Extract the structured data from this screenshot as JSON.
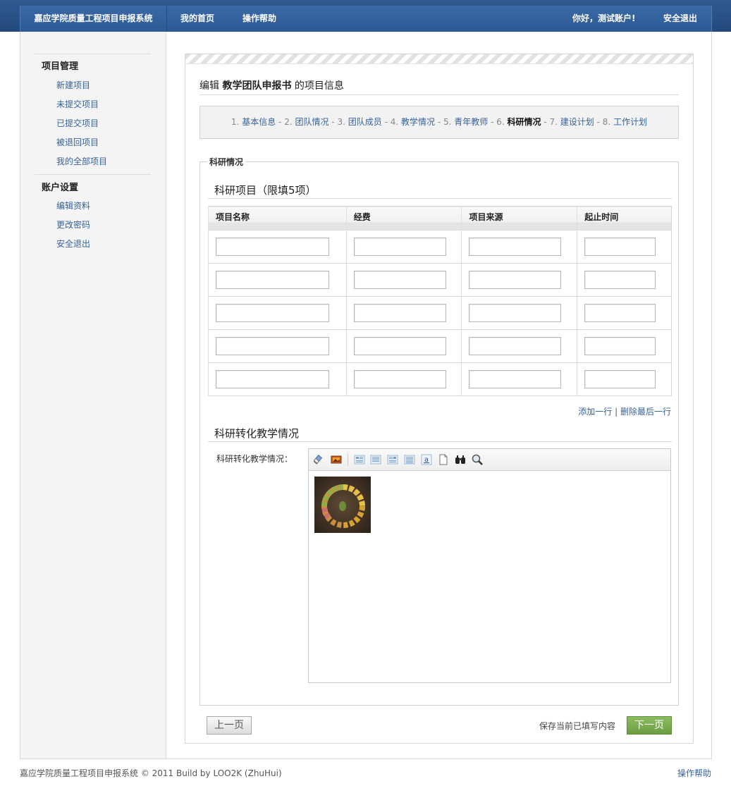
{
  "header": {
    "brand": "嘉应学院质量工程项目申报系统",
    "nav": [
      "我的首页",
      "操作帮助"
    ],
    "greeting": "你好，测试账户!",
    "logout": "安全退出"
  },
  "sidebar": {
    "groups": [
      {
        "title": "项目管理",
        "items": [
          "新建项目",
          "未提交项目",
          "已提交项目",
          "被退回项目",
          "我的全部项目"
        ]
      },
      {
        "title": "账户设置",
        "items": [
          "编辑资料",
          "更改密码",
          "安全退出"
        ]
      }
    ]
  },
  "main": {
    "title_prefix": "编辑",
    "title_bold": "教学团队申报书",
    "title_suffix": "的项目信息",
    "steps": [
      {
        "num": "1.",
        "label": "基本信息"
      },
      {
        "num": "2.",
        "label": "团队情况"
      },
      {
        "num": "3.",
        "label": "团队成员"
      },
      {
        "num": "4.",
        "label": "教学情况"
      },
      {
        "num": "5.",
        "label": "青年教师"
      },
      {
        "num": "6.",
        "label": "科研情况",
        "current": true
      },
      {
        "num": "7.",
        "label": "建设计划"
      },
      {
        "num": "8.",
        "label": "工作计划"
      }
    ],
    "step_separator": " - ",
    "fieldset_legend": "科研情况",
    "projects_title": "科研项目（限填5项）",
    "table": {
      "headers": [
        "项目名称",
        "经费",
        "项目来源",
        "起止时间"
      ],
      "rows": [
        [
          "",
          "",
          "",
          ""
        ],
        [
          "",
          "",
          "",
          ""
        ],
        [
          "",
          "",
          "",
          ""
        ],
        [
          "",
          "",
          "",
          ""
        ],
        [
          "",
          "",
          "",
          ""
        ]
      ]
    },
    "add_row": "添加一行",
    "row_sep": "|",
    "delete_row": "删除最后一行",
    "transfer_title": "科研转化教学情况",
    "editor_label": "科研转化教学情况：",
    "editor_toolbar": [
      "eraser-icon",
      "image-icon",
      "align-left-icon",
      "align-center-icon",
      "align-right-icon",
      "align-justify-icon",
      "special-char-icon",
      "new-page-icon",
      "find-icon",
      "preview-icon"
    ],
    "prev_button": "上一页",
    "save_link": "保存当前已填写内容",
    "next_button": "下一页"
  },
  "footer": {
    "copyright": "嘉应学院质量工程项目申报系统 © 2011 Build by LOO2K (ZhuHui)",
    "help": "操作帮助"
  },
  "colors": {
    "header_bg": "#2c5a95",
    "link": "#36639c",
    "next_button": "#7aad50"
  }
}
